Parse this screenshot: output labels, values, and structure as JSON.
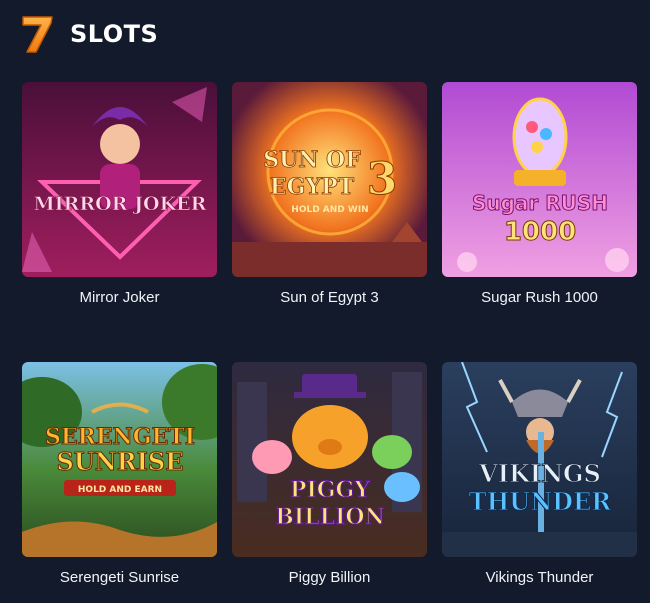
{
  "section": {
    "title": "SLOTS",
    "logo_icon": "seven-logo-icon"
  },
  "games": [
    {
      "title": "Mirror Joker",
      "art_title": "MIRROR JOKER",
      "palette": [
        "#7a1e57",
        "#e04a9a"
      ]
    },
    {
      "title": "Sun of Egypt 3",
      "art_title": "SUN OF EGYPT 3",
      "art_subtitle": "HOLD AND WIN",
      "palette": [
        "#e65a1e",
        "#ffd35a"
      ]
    },
    {
      "title": "Sugar Rush 1000",
      "art_title": "SUGAR RUSH",
      "art_subtitle": "1000",
      "palette": [
        "#c65ad8",
        "#ffb0e6"
      ]
    },
    {
      "title": "Serengeti Sunrise",
      "art_title": "SERENGETI SUNRISE",
      "art_subtitle": "HOLD AND EARN",
      "palette": [
        "#2f6b2a",
        "#f3a322"
      ]
    },
    {
      "title": "Piggy Billion",
      "art_title": "PIGGY BILLION",
      "palette": [
        "#3b2f5a",
        "#ff8aa8"
      ]
    },
    {
      "title": "Vikings Thunder",
      "art_title": "VIKINGS THUNDER",
      "palette": [
        "#1e2f47",
        "#5ab8f0"
      ]
    }
  ]
}
